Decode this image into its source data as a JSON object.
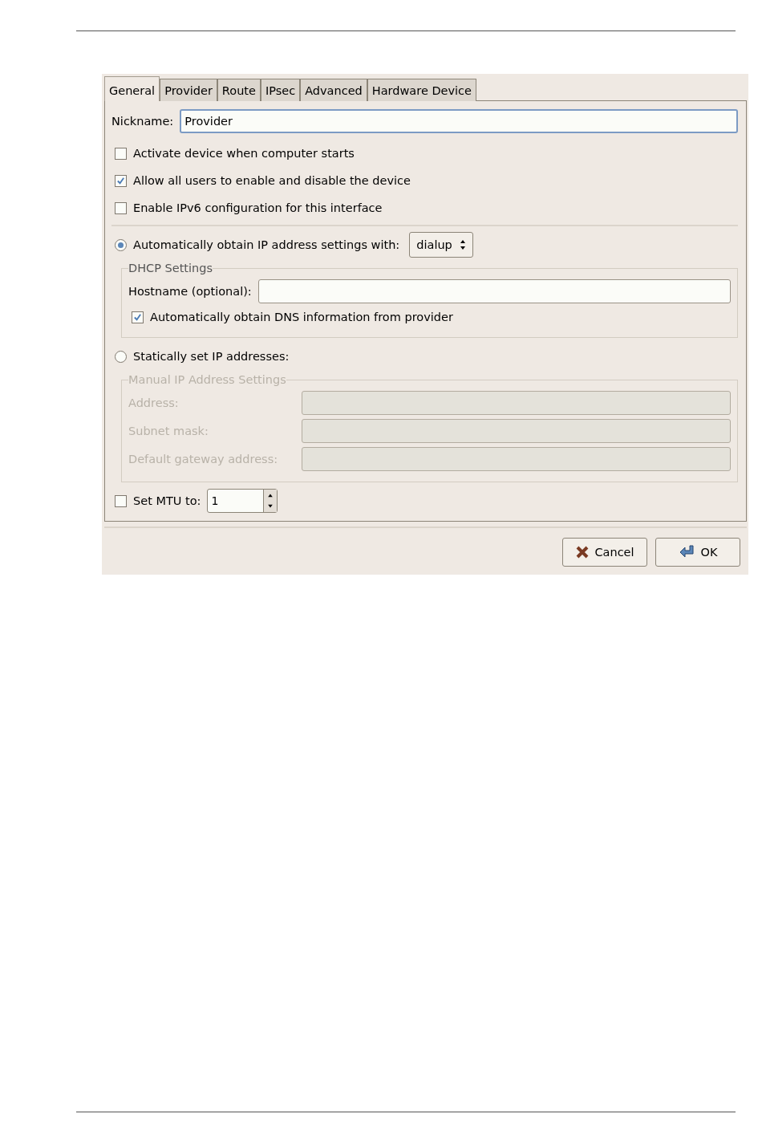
{
  "tabs": [
    {
      "label": "General",
      "selected": true
    },
    {
      "label": "Provider",
      "selected": false
    },
    {
      "label": "Route",
      "selected": false
    },
    {
      "label": "IPsec",
      "selected": false
    },
    {
      "label": "Advanced",
      "selected": false
    },
    {
      "label": "Hardware Device",
      "selected": false
    }
  ],
  "nickname": {
    "label": "Nickname:",
    "value": "Provider"
  },
  "options": [
    {
      "label": "Activate device when computer starts",
      "checked": false
    },
    {
      "label": "Allow all users to enable and disable the device",
      "checked": true
    },
    {
      "label": "Enable IPv6 configuration for this interface",
      "checked": false
    }
  ],
  "automatic": {
    "label": "Automatically obtain IP address settings with:",
    "selected": true,
    "combo": "dialup"
  },
  "dhcp": {
    "title": "DHCP Settings",
    "hostname_label": "Hostname (optional):",
    "dns": {
      "label": "Automatically obtain DNS information from provider",
      "checked": true
    }
  },
  "static": {
    "label": "Statically set IP addresses:",
    "selected": false
  },
  "manual": {
    "title": "Manual IP Address Settings",
    "disabled": true,
    "fields": [
      {
        "label": "Address:"
      },
      {
        "label": "Subnet mask:"
      },
      {
        "label": "Default gateway address:"
      }
    ]
  },
  "mtu": {
    "label": "Set MTU to:",
    "checked": false,
    "value": "1"
  },
  "buttons": [
    {
      "kind": "cancel",
      "label": "Cancel"
    },
    {
      "kind": "ok",
      "label": "OK"
    }
  ]
}
